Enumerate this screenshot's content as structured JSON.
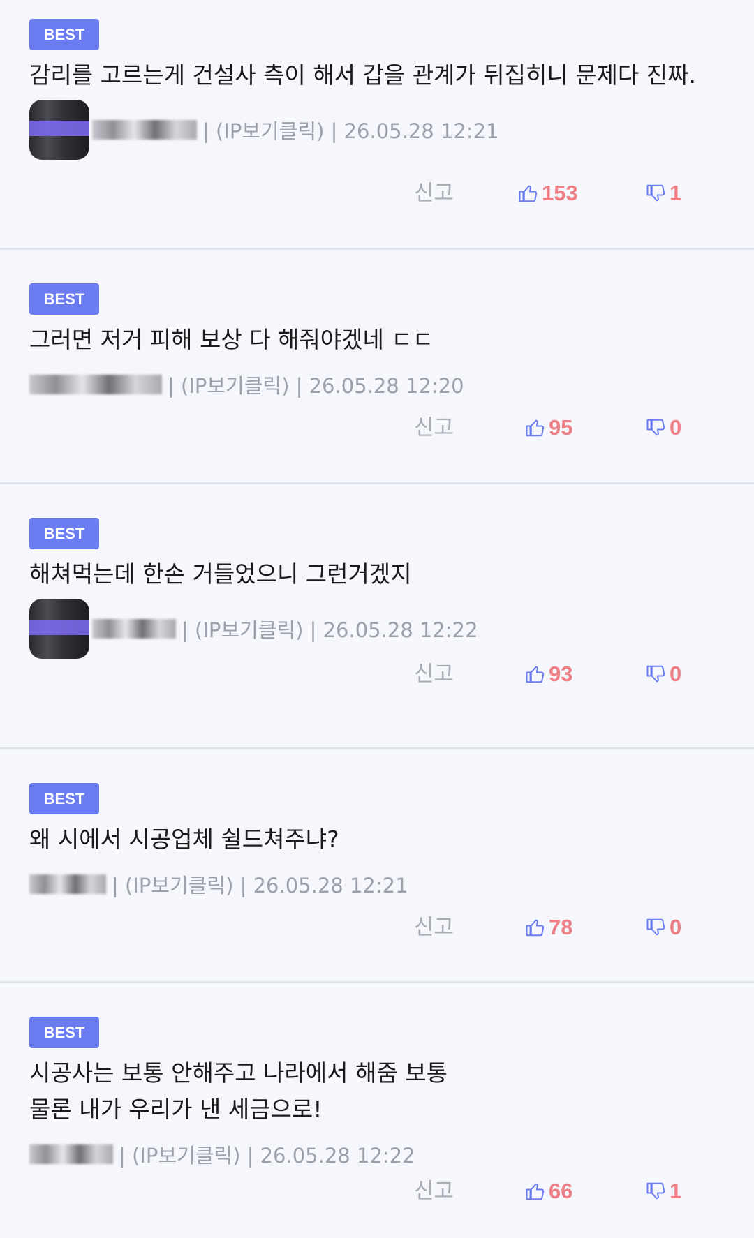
{
  "comments": [
    {
      "badge": "BEST",
      "text": "감리를 고르는게 건설사 측이 해서 갑을 관계가 뒤집히니 문제다 진짜.",
      "info": "| (IP보기클릭) | 26.05.28 12:21",
      "report": "신고",
      "likes": "153",
      "dislikes": "1"
    },
    {
      "badge": "BEST",
      "text": "그러면 저거 피해 보상 다 해줘야겠네 ㄷㄷ",
      "info": "| (IP보기클릭) | 26.05.28 12:20",
      "report": "신고",
      "likes": "95",
      "dislikes": "0"
    },
    {
      "badge": "BEST",
      "text": "해쳐먹는데 한손 거들었으니 그런거겠지",
      "info": "| (IP보기클릭) | 26.05.28 12:22",
      "report": "신고",
      "likes": "93",
      "dislikes": "0"
    },
    {
      "badge": "BEST",
      "text": "왜 시에서 시공업체 쉴드쳐주냐?",
      "info": "| (IP보기클릭) | 26.05.28 12:21",
      "report": "신고",
      "likes": "78",
      "dislikes": "0"
    },
    {
      "badge": "BEST",
      "text": "시공사는 보통 안해주고 나라에서 해줌 보통 물론 내가 우리가 낸 세금으로!",
      "info": "| (IP보기클릭) | 26.05.28 12:22",
      "report": "신고",
      "likes": "66",
      "dislikes": "1"
    }
  ],
  "colors": {
    "badge": "#6b7cf0",
    "vote": "#ee7f86",
    "thumb_up": "#6b7cf0",
    "thumb_down": "#6b7cf0"
  },
  "icons": {
    "up": "thumbs-up-icon",
    "down": "thumbs-down-icon"
  }
}
